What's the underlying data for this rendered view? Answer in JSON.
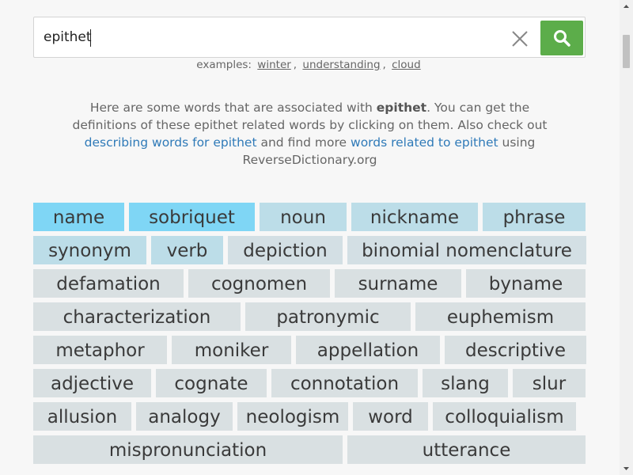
{
  "search": {
    "value": "epithet",
    "placeholder": ""
  },
  "examples": {
    "prefix": "examples:",
    "links": [
      "winter",
      "understanding",
      "cloud"
    ],
    "separators": [
      ",",
      ","
    ]
  },
  "intro": {
    "part1": "Here are some words that are associated with ",
    "word": "epithet",
    "part2": ". You can get the definitions of these epithet related words by clicking on them. Also check out ",
    "link1": "describing words for epithet",
    "part3": " and find more ",
    "link2": "words related to epithet",
    "part4": " using ReverseDictionary.org"
  },
  "colors": {
    "strong_tag": "#7fd6f5",
    "medium_tag": "#bcdde8",
    "weak_tag": "#d3dfe4",
    "weakest_tag": "#d9e0e2",
    "search_button": "#5cad4a",
    "link": "#2f7ab8"
  },
  "tags": [
    [
      "name",
      "sobriquet",
      "noun",
      "nickname",
      "phrase"
    ],
    [
      "synonym",
      "verb",
      "depiction",
      "binomial nomenclature"
    ],
    [
      "defamation",
      "cognomen",
      "surname",
      "byname"
    ],
    [
      "characterization",
      "patronymic",
      "euphemism"
    ],
    [
      "metaphor",
      "moniker",
      "appellation",
      "descriptive"
    ],
    [
      "adjective",
      "cognate",
      "connotation",
      "slang",
      "slur"
    ],
    [
      "allusion",
      "analogy",
      "neologism",
      "word",
      "colloquialism"
    ],
    [
      "mispronunciation",
      "utterance"
    ]
  ],
  "tag_strength": [
    [
      "strong",
      "strong",
      "medium",
      "medium",
      "medium"
    ],
    [
      "medium",
      "medium",
      "weak",
      "weak"
    ],
    [
      "weakest",
      "weakest",
      "weakest",
      "weakest"
    ],
    [
      "weakest",
      "weakest",
      "weakest"
    ],
    [
      "weakest",
      "weakest",
      "weakest",
      "weakest"
    ],
    [
      "weakest",
      "weakest",
      "weakest",
      "weakest",
      "weakest"
    ],
    [
      "weakest",
      "weakest",
      "weakest",
      "weakest",
      "weakest"
    ],
    [
      "weakest",
      "weakest"
    ]
  ]
}
